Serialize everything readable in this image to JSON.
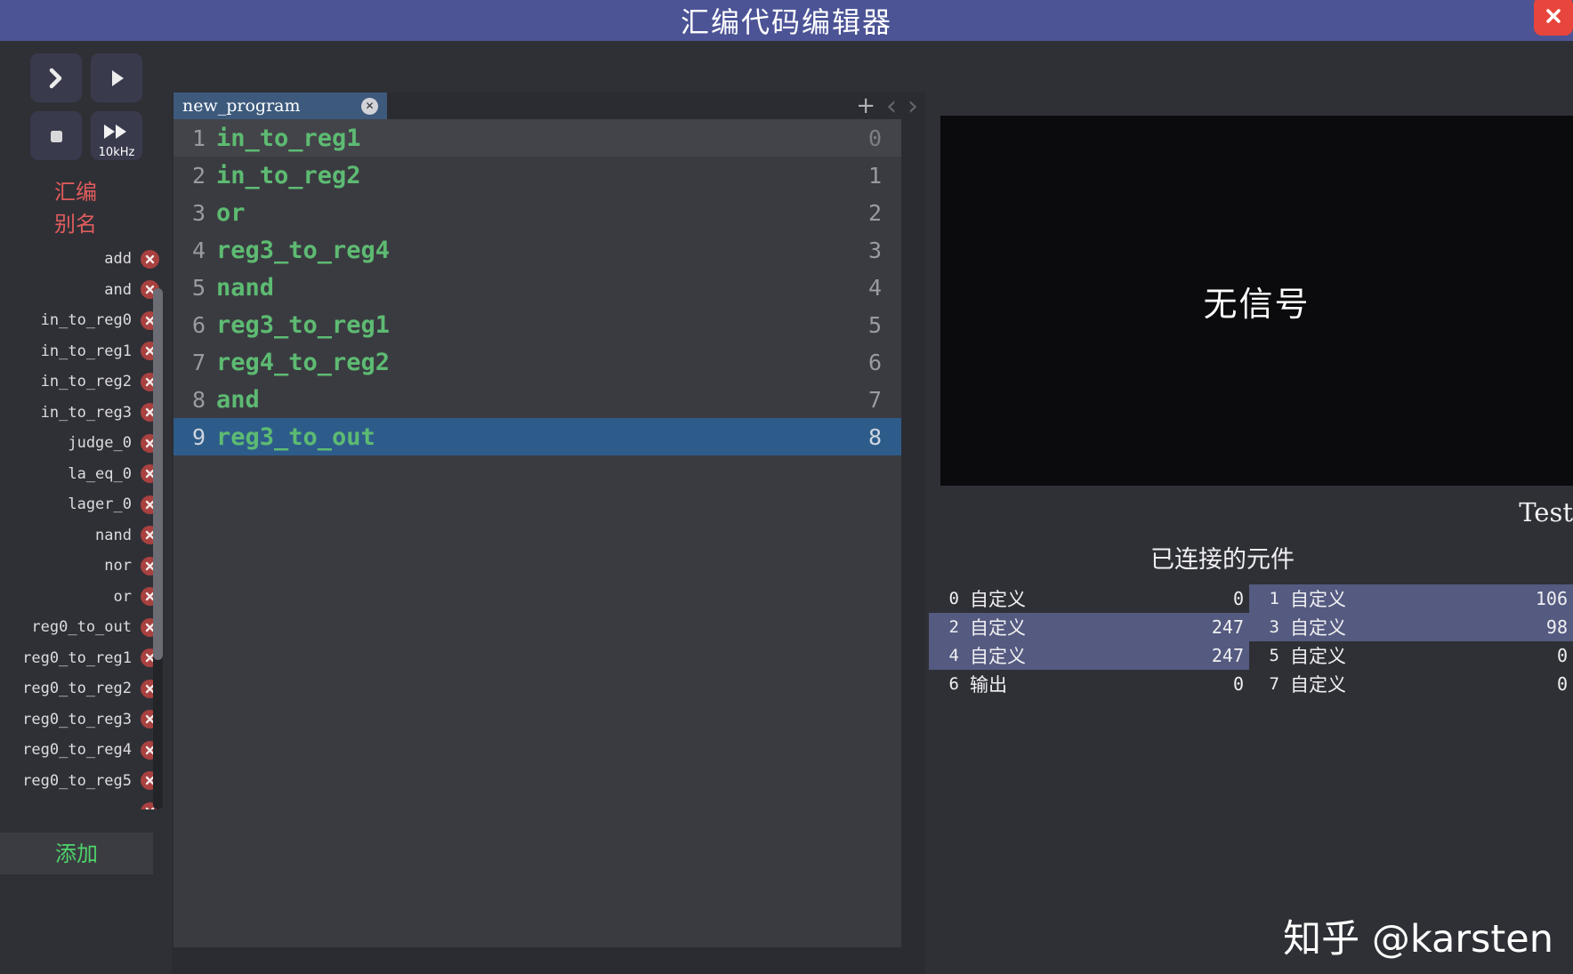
{
  "window": {
    "title": "汇编代码编辑器",
    "close_icon": "close-icon",
    "accent_titlebar": "#4c5496",
    "accent_close": "#e8453c"
  },
  "sidebar": {
    "transport": [
      {
        "name": "step-button",
        "icon": "chevron-right-icon"
      },
      {
        "name": "run-button",
        "icon": "play-icon"
      },
      {
        "name": "stop-button",
        "icon": "stop-square-icon"
      },
      {
        "name": "fast-forward-button",
        "icon": "fast-forward-icon",
        "label": "10kHz"
      }
    ],
    "heading_line1": "汇编",
    "heading_line2": "别名",
    "heading_color": "#e05c5c",
    "delete_icon": "delete-circle-icon",
    "aliases": [
      "add",
      "and",
      "in_to_reg0",
      "in_to_reg1",
      "in_to_reg2",
      "in_to_reg3",
      "judge_0",
      "la_eq_0",
      "lager_0",
      "nand",
      "nor",
      "or",
      "reg0_to_out",
      "reg0_to_reg1",
      "reg0_to_reg2",
      "reg0_to_reg3",
      "reg0_to_reg4",
      "reg0_to_reg5",
      "· ·      ·"
    ],
    "add_label": "添加",
    "add_color": "#4ed36a"
  },
  "editor": {
    "tab": {
      "label": "new_program",
      "close_icon": "close-circle-icon"
    },
    "actions": [
      {
        "name": "new-tab-button",
        "glyph": "+"
      },
      {
        "name": "prev-tab-button",
        "glyph": "‹"
      },
      {
        "name": "next-tab-button",
        "glyph": "›"
      }
    ],
    "lines": [
      {
        "num": "1",
        "text": "in_to_reg1",
        "addr": "0",
        "state": "current"
      },
      {
        "num": "2",
        "text": "in_to_reg2",
        "addr": "1",
        "state": ""
      },
      {
        "num": "3",
        "text": "or",
        "addr": "2",
        "state": ""
      },
      {
        "num": "4",
        "text": "reg3_to_reg4",
        "addr": "3",
        "state": ""
      },
      {
        "num": "5",
        "text": "nand",
        "addr": "4",
        "state": ""
      },
      {
        "num": "6",
        "text": "reg3_to_reg1",
        "addr": "5",
        "state": ""
      },
      {
        "num": "7",
        "text": "reg4_to_reg2",
        "addr": "6",
        "state": ""
      },
      {
        "num": "8",
        "text": "and",
        "addr": "7",
        "state": ""
      },
      {
        "num": "9",
        "text": "reg3_to_out",
        "addr": "8",
        "state": "selected"
      }
    ]
  },
  "monitor": {
    "no_signal_text": "无信号",
    "screen_color": "#0b0b0d"
  },
  "components": {
    "test_label": "Test",
    "title": "已连接的元件",
    "highlight_color": "#545a80",
    "items": [
      {
        "index": "0",
        "name": "自定义",
        "value": "0",
        "highlight": false,
        "col": "left"
      },
      {
        "index": "1",
        "name": "自定义",
        "value": "106",
        "highlight": true,
        "col": "right"
      },
      {
        "index": "2",
        "name": "自定义",
        "value": "247",
        "highlight": true,
        "col": "left"
      },
      {
        "index": "3",
        "name": "自定义",
        "value": "98",
        "highlight": true,
        "col": "right"
      },
      {
        "index": "4",
        "name": "自定义",
        "value": "247",
        "highlight": true,
        "col": "left"
      },
      {
        "index": "5",
        "name": "自定义",
        "value": "0",
        "highlight": false,
        "col": "right"
      },
      {
        "index": "6",
        "name": "输出",
        "value": "0",
        "highlight": false,
        "col": "left"
      },
      {
        "index": "7",
        "name": "自定义",
        "value": "0",
        "highlight": false,
        "col": "right"
      }
    ]
  },
  "watermark": {
    "text": "知乎 @karsten"
  }
}
